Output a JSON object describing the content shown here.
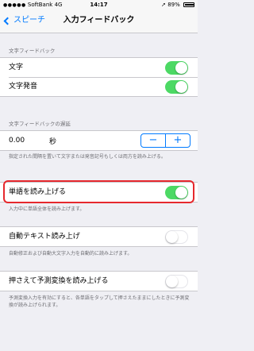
{
  "status": {
    "carrier": "SoftBank",
    "network": "4G",
    "time": "14:17",
    "battery": "89%"
  },
  "nav": {
    "back_label": "スピーチ",
    "title": "入力フィードバック"
  },
  "text_feedback": {
    "header": "文字フィードバック",
    "rows": [
      {
        "label": "文字",
        "on": true
      },
      {
        "label": "文字発音",
        "on": true
      }
    ]
  },
  "delay": {
    "header": "文字フィードバックの遅延",
    "value": "0.00",
    "unit": "秒",
    "minus": "−",
    "plus": "+",
    "footer": "指定された間隔を置いて文字または発音記号もしくは両方を読み上げる。"
  },
  "speak_words": {
    "label": "単語を読み上げる",
    "on": true,
    "footer": "入力中に単語全体を読み上げます。"
  },
  "auto_text": {
    "label": "自動テキスト読み上げ",
    "on": false,
    "footer": "自動修正および自動大文字入力を自動的に読み上げます。"
  },
  "predictive": {
    "label": "押さえて予測変換を読み上げる",
    "on": false,
    "footer": "予測変換入力を有効にすると、各単語をタップして押さえたままにしたときに予測変換が読み上げられます。"
  },
  "colors": {
    "accent": "#007aff",
    "toggle_on": "#4cd964",
    "highlight": "#e6282d"
  }
}
